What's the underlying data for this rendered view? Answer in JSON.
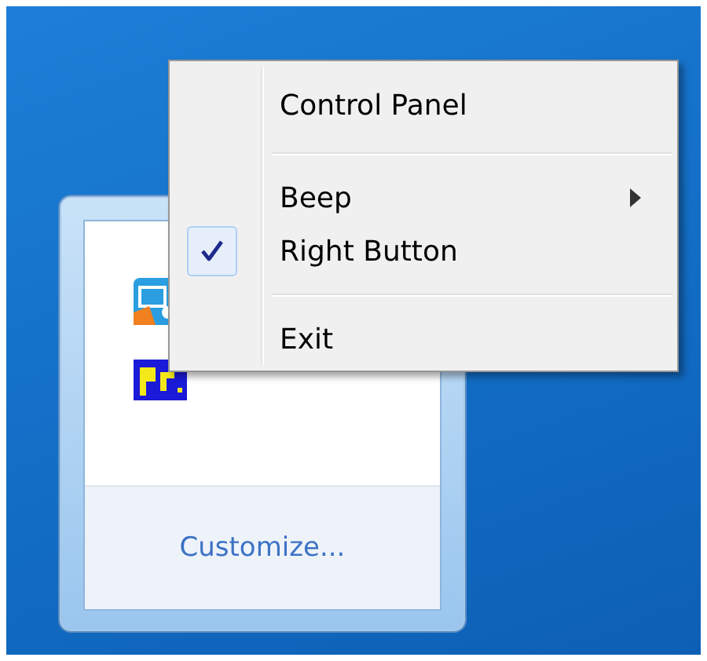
{
  "tray_popup": {
    "customize_link": "Customize..."
  },
  "context_menu": {
    "items": [
      {
        "kind": "item",
        "label": "Control Panel",
        "checked": false,
        "submenu": false
      },
      {
        "kind": "separator"
      },
      {
        "kind": "item",
        "label": "Beep",
        "checked": false,
        "submenu": true
      },
      {
        "kind": "item",
        "label": "Right Button",
        "checked": true,
        "submenu": false
      },
      {
        "kind": "separator"
      },
      {
        "kind": "item",
        "label": "Exit",
        "checked": false,
        "submenu": false
      }
    ]
  }
}
